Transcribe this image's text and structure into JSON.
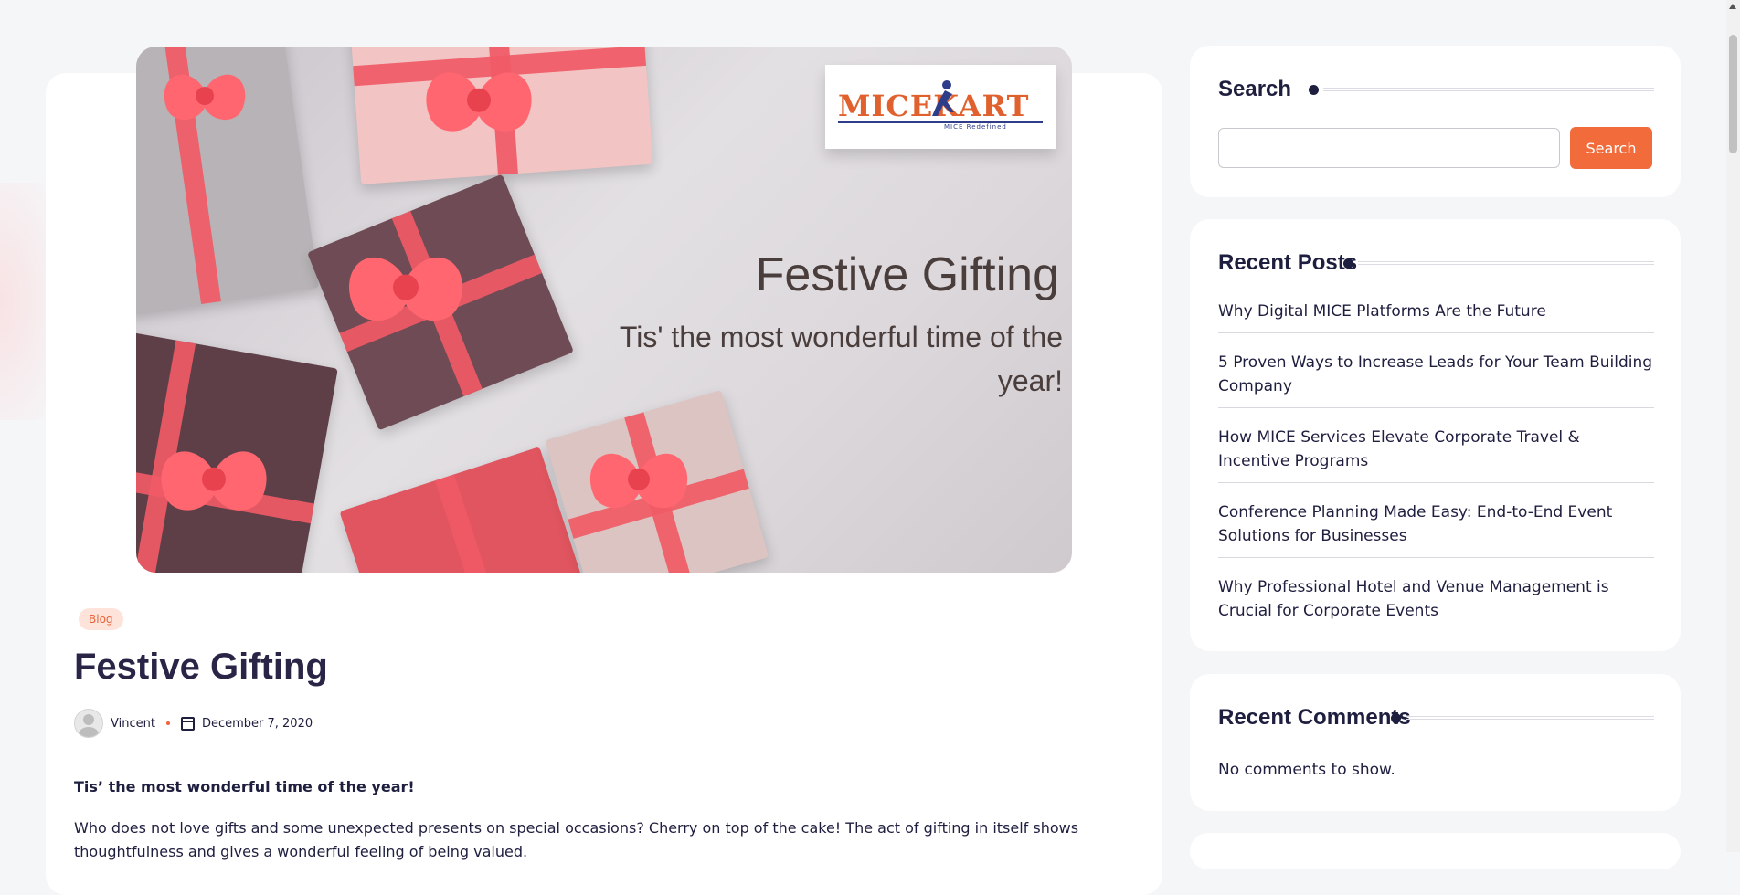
{
  "hero": {
    "logo_text": "MICEKART",
    "logo_tagline": "MICE Redefined",
    "title": "Festive Gifting",
    "subtitle": "Tis' the most wonderful time of the year!"
  },
  "article": {
    "category": "Blog",
    "title": "Festive Gifting",
    "author": "Vincent",
    "date": "December 7, 2020",
    "lead": "Tis’ the most wonderful time of the year!",
    "paragraph": "Who does not love gifts and some unexpected presents on special occasions? Cherry on top of the cake! The act of gifting in itself shows thoughtfulness and gives a wonderful feeling of being valued."
  },
  "sidebar": {
    "search": {
      "title": "Search",
      "input_value": "",
      "button_label": "Search"
    },
    "recent_posts": {
      "title": "Recent Posts",
      "items": [
        "Why Digital MICE Platforms Are the Future",
        "5 Proven Ways to Increase Leads for Your Team Building Company",
        "How MICE Services Elevate Corporate Travel & Incentive Programs",
        "Conference Planning Made Easy: End-to-End Event Solutions for Businesses",
        "Why Professional Hotel and Venue Management is Crucial for Corporate Events"
      ]
    },
    "recent_comments": {
      "title": "Recent Comments",
      "empty_text": "No comments to show."
    }
  },
  "colors": {
    "accent": "#f26b3a",
    "heading": "#1e1e3f",
    "badge_bg": "#fde3da"
  }
}
